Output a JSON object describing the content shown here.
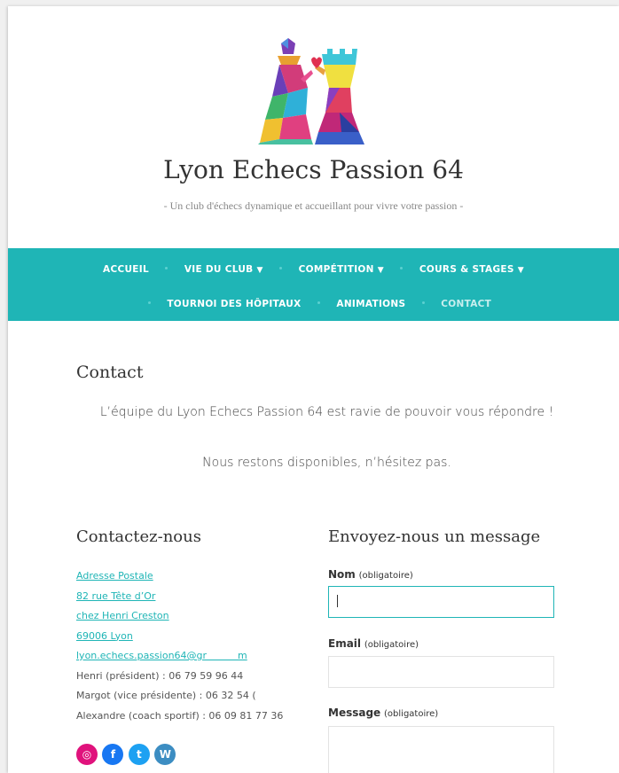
{
  "site": {
    "title": "Lyon Echecs Passion 64",
    "tagline": "- Un club d'échecs dynamique et accueillant pour vivre votre passion -"
  },
  "nav": {
    "row1": [
      "ACCUEIL",
      "VIE DU CLUB",
      "COMPÉTITION",
      "COURS & STAGES"
    ],
    "row2": [
      "TOURNOI DES HÔPITAUX",
      "ANIMATIONS",
      "CONTACT"
    ],
    "active": "CONTACT"
  },
  "page": {
    "title": "Contact",
    "intro1": "L’équipe du Lyon Echecs Passion 64 est ravie de pouvoir vous répondre !",
    "intro2": "Nous restons disponibles, n’hésitez pas."
  },
  "contact": {
    "title": "Contactez-nous",
    "links": [
      "Adresse Postale",
      "82 rue Tête d’Or",
      "chez Henri Creston",
      "69006 Lyon",
      "lyon.echecs.passion64@gr          m"
    ],
    "phones": [
      "Henri (président) : 06 79 59 96 44",
      "Margot (vice présidente) : 06 32 54 (",
      "Alexandre (coach sportif) : 06 09 81 77 36"
    ],
    "socials": [
      "instagram-icon",
      "facebook-icon",
      "twitter-icon",
      "wordpress-icon"
    ],
    "social_colors": [
      "#e0127c",
      "#1877f2",
      "#1da1f2",
      "#3c8dc2"
    ]
  },
  "form": {
    "title": "Envoyez-nous un message",
    "name_label": "Nom",
    "email_label": "Email",
    "message_label": "Message",
    "required": "(obligatoire)"
  },
  "colors": {
    "accent": "#1fb5b6"
  }
}
